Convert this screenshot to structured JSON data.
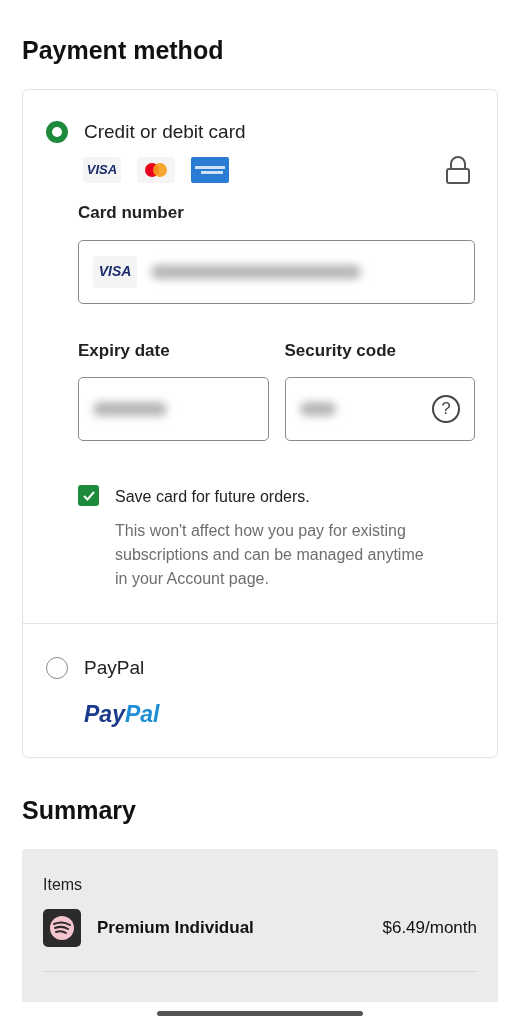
{
  "payment": {
    "title": "Payment method",
    "options": [
      {
        "kind": "card",
        "label": "Credit or debit card",
        "selected": true,
        "brands": [
          {
            "kind": "visa",
            "text": "VISA"
          },
          {
            "kind": "mastercard"
          },
          {
            "kind": "amex"
          }
        ],
        "card_number": {
          "label": "Card number",
          "brand_text": "VISA"
        },
        "expiry": {
          "label": "Expiry date"
        },
        "security_code": {
          "label": "Security code",
          "help": "?"
        },
        "save_card": {
          "label": "Save card for future orders.",
          "checked": true,
          "note": "This won't affect how you pay for existing subscriptions and can be managed anytime in your Account page."
        }
      },
      {
        "kind": "paypal",
        "label": "PayPal",
        "selected": false,
        "logo_parts": [
          "Pay",
          "Pal"
        ]
      }
    ]
  },
  "summary": {
    "title": "Summary",
    "section": "Items",
    "items": [
      {
        "name": "Premium Individual",
        "price": "$6.49/month"
      }
    ]
  }
}
